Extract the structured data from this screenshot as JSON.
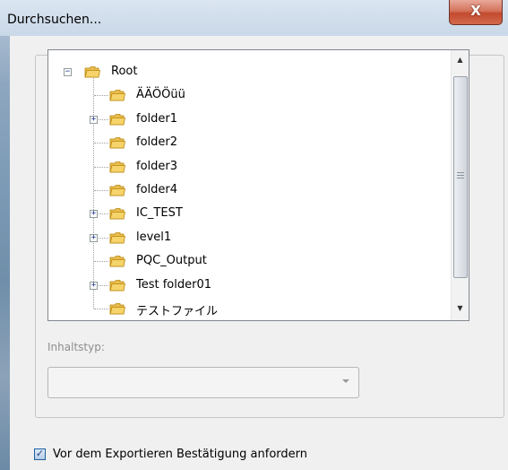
{
  "window": {
    "title": "Durchsuchen...",
    "close_label": "X"
  },
  "tree": {
    "items": [
      {
        "label": "Root",
        "expander": "−"
      },
      {
        "label": "ÄÄÖÖüü",
        "expander": ""
      },
      {
        "label": "folder1",
        "expander": "+"
      },
      {
        "label": "folder2",
        "expander": ""
      },
      {
        "label": "folder3",
        "expander": ""
      },
      {
        "label": "folder4",
        "expander": ""
      },
      {
        "label": "IC_TEST",
        "expander": "+"
      },
      {
        "label": "level1",
        "expander": "+"
      },
      {
        "label": "PQC_Output",
        "expander": ""
      },
      {
        "label": "Test folder01",
        "expander": "+"
      },
      {
        "label": "テストファイル",
        "expander": ""
      }
    ],
    "scroll_up": "▲",
    "scroll_down": "▼"
  },
  "content_type": {
    "label": "Inhaltstyp:",
    "value": ""
  },
  "confirm": {
    "checked": true,
    "check_mark": "✓",
    "label": "Vor dem Exportieren Bestätigung anfordern"
  },
  "colors": {
    "folder_fill": "#f6d36b",
    "folder_stroke": "#b8860b",
    "close_button": "#c34a2f"
  }
}
